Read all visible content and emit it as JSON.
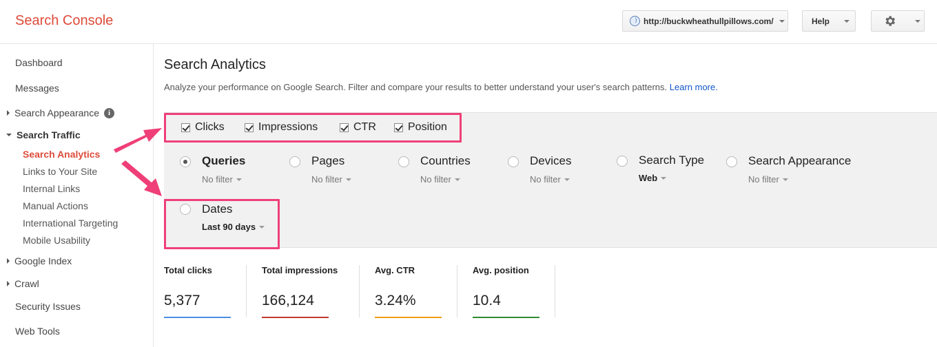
{
  "header": {
    "app_title": "Search Console",
    "site_url": "http://buckwheathullpillows.com/",
    "help_label": "Help",
    "settings_icon": "gear-icon"
  },
  "sidebar": {
    "items": [
      {
        "label": "Dashboard"
      },
      {
        "label": "Messages"
      },
      {
        "label": "Search Appearance"
      },
      {
        "label": "Search Traffic"
      },
      {
        "label": "Google Index"
      },
      {
        "label": "Crawl"
      },
      {
        "label": "Security Issues"
      },
      {
        "label": "Web Tools"
      }
    ],
    "subitems": [
      {
        "label": "Search Analytics"
      },
      {
        "label": "Links to Your Site"
      },
      {
        "label": "Internal Links"
      },
      {
        "label": "Manual Actions"
      },
      {
        "label": "International Targeting"
      },
      {
        "label": "Mobile Usability"
      }
    ]
  },
  "main": {
    "title": "Search Analytics",
    "description": "Analyze your performance on Google Search. Filter and compare your results to better understand your user's search patterns.",
    "learn_more": "Learn more.",
    "metrics": [
      {
        "label": "Clicks",
        "checked": true
      },
      {
        "label": "Impressions",
        "checked": true
      },
      {
        "label": "CTR",
        "checked": true
      },
      {
        "label": "Position",
        "checked": true
      }
    ],
    "groups": [
      {
        "label": "Queries",
        "filter": "No filter",
        "selected": true
      },
      {
        "label": "Pages",
        "filter": "No filter"
      },
      {
        "label": "Countries",
        "filter": "No filter"
      },
      {
        "label": "Devices",
        "filter": "No filter"
      },
      {
        "label": "Search Type",
        "filter": "Web"
      },
      {
        "label": "Search Appearance",
        "filter": "No filter"
      },
      {
        "label": "Dates",
        "filter": "Last 90 days"
      }
    ],
    "stats": [
      {
        "label": "Total clicks",
        "value": "5,377",
        "color": "#4a90e2"
      },
      {
        "label": "Total impressions",
        "value": "166,124",
        "color": "#c0392b"
      },
      {
        "label": "Avg. CTR",
        "value": "3.24%",
        "color": "#f39c12"
      },
      {
        "label": "Avg. position",
        "value": "10.4",
        "color": "#2e8b2e"
      }
    ]
  },
  "colors": {
    "brand": "#dd4b39",
    "highlight": "#ef3f78",
    "link": "#1155cc"
  }
}
